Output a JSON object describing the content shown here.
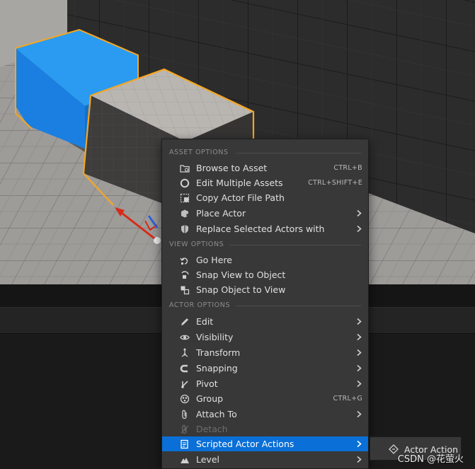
{
  "menu": {
    "sections": {
      "asset": "ASSET OPTIONS",
      "view": "VIEW OPTIONS",
      "actor": "ACTOR OPTIONS"
    },
    "items": {
      "browse_to_asset": {
        "label": "Browse to Asset",
        "shortcut": "CTRL+B",
        "icon": "browse-folder-icon"
      },
      "edit_multiple_assets": {
        "label": "Edit Multiple Assets",
        "shortcut": "CTRL+SHIFT+E",
        "icon": "circle-icon"
      },
      "copy_actor_file_path": {
        "label": "Copy Actor File Path",
        "icon": "copy-path-icon"
      },
      "place_actor": {
        "label": "Place Actor",
        "icon": "place-actor-icon",
        "submenu": true
      },
      "replace_selected_actors": {
        "label": "Replace Selected Actors with",
        "icon": "replace-shield-icon",
        "submenu": true
      },
      "go_here": {
        "label": "Go Here",
        "icon": "go-here-icon"
      },
      "snap_view_to_object": {
        "label": "Snap View to Object",
        "icon": "snap-view-icon"
      },
      "snap_object_to_view": {
        "label": "Snap Object to View",
        "icon": "snap-object-icon"
      },
      "edit": {
        "label": "Edit",
        "icon": "pencil-icon",
        "submenu": true
      },
      "visibility": {
        "label": "Visibility",
        "icon": "eye-icon",
        "submenu": true
      },
      "transform": {
        "label": "Transform",
        "icon": "transform-icon",
        "submenu": true
      },
      "snapping": {
        "label": "Snapping",
        "icon": "magnet-icon",
        "submenu": true
      },
      "pivot": {
        "label": "Pivot",
        "icon": "pivot-icon",
        "submenu": true
      },
      "group": {
        "label": "Group",
        "shortcut": "CTRL+G",
        "icon": "group-icon"
      },
      "attach_to": {
        "label": "Attach To",
        "icon": "paperclip-icon",
        "submenu": true
      },
      "detach": {
        "label": "Detach",
        "icon": "detach-icon",
        "disabled": true
      },
      "scripted_actor_actions": {
        "label": "Scripted Actor Actions",
        "icon": "script-icon",
        "submenu": true,
        "highlighted": true
      },
      "level": {
        "label": "Level",
        "icon": "level-icon",
        "submenu": true
      }
    }
  },
  "submenu": {
    "label": "Actor Action",
    "icon": "actor-action-icon"
  },
  "watermark": "CSDN @花萤火",
  "colors": {
    "menu_bg": "#383838",
    "highlight": "#0a6fd6",
    "selected_outline": "#f5a623",
    "blue_cube": "#1f8be6",
    "gizmo_red": "#d62a1a",
    "gizmo_blue": "#2b63d9"
  }
}
